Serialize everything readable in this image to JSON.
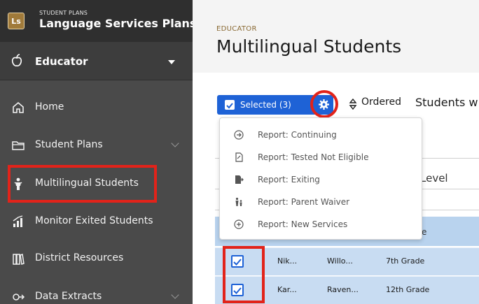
{
  "sidebar": {
    "brand_small": "STUDENT PLANS",
    "brand_big": "Language Services Plans",
    "logo_text": "Ls",
    "role": "Educator",
    "items": [
      {
        "label": "Home",
        "icon": "home-icon"
      },
      {
        "label": "Student Plans",
        "icon": "folder-icon"
      },
      {
        "label": "Multilingual Students",
        "icon": "student-icon"
      },
      {
        "label": "Monitor Exited Students",
        "icon": "chart-icon"
      },
      {
        "label": "District Resources",
        "icon": "books-icon"
      },
      {
        "label": "Data Extracts",
        "icon": "extract-icon"
      }
    ]
  },
  "main": {
    "eyebrow": "EDUCATOR",
    "title": "Multilingual Students",
    "selected_label": "Selected (3)",
    "ordered_label": "Ordered",
    "students_label": "Students w",
    "level_header": "Level",
    "header_partial": "e",
    "rows": [
      {
        "first": "Nik...",
        "last": "Willo...",
        "grade": "7th Grade"
      },
      {
        "first": "Kar...",
        "last": "Raven...",
        "grade": "12th Grade"
      }
    ]
  },
  "dropdown": {
    "items": [
      {
        "label": "Report: Continuing",
        "icon": "arrow-circle-icon"
      },
      {
        "label": "Report: Tested Not Eligible",
        "icon": "document-icon"
      },
      {
        "label": "Report: Exiting",
        "icon": "exit-document-icon"
      },
      {
        "label": "Report: Parent Waiver",
        "icon": "parent-icon"
      },
      {
        "label": "Report: New Services",
        "icon": "plus-circle-icon"
      }
    ]
  },
  "colors": {
    "sidebar": "#4a4a4a",
    "brand_bar": "#2f2f2f",
    "primary_blue": "#1e62d6",
    "highlight_red": "#e2231a",
    "row_blue": "#c8dcf2"
  }
}
